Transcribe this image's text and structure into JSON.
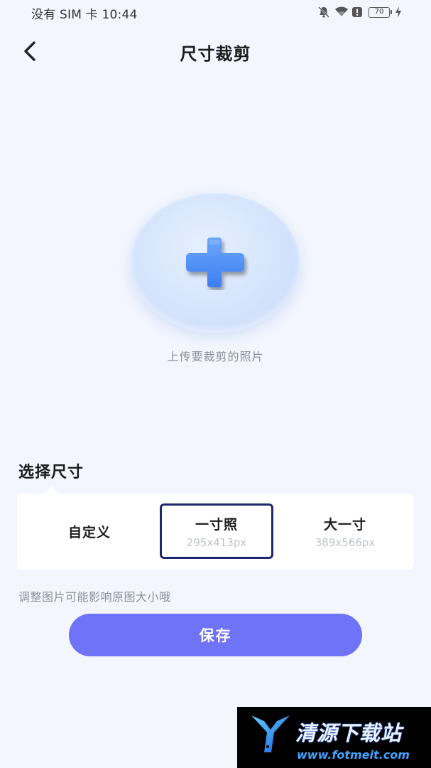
{
  "status_bar": {
    "carrier_time": "没有 SIM 卡 10:44",
    "battery": "70",
    "icons": [
      "bell-off-icon",
      "wifi-icon",
      "alert-icon",
      "battery-icon",
      "charging-icon"
    ]
  },
  "nav": {
    "back_icon": "chevron-left-icon",
    "title": "尺寸裁剪"
  },
  "upload": {
    "icon": "plus-icon",
    "hint": "上传要裁剪的照片"
  },
  "size_section": {
    "title": "选择尺寸",
    "selected_index": 1,
    "options": [
      {
        "label": "自定义",
        "dimension": ""
      },
      {
        "label": "一寸照",
        "dimension": "295x413px"
      },
      {
        "label": "大一寸",
        "dimension": "389x566px"
      }
    ]
  },
  "note": "调整图片可能影响原图大小哦",
  "save_label": "保存",
  "watermark": {
    "text": "清源下载站",
    "url": "www.fotmeit.com"
  },
  "colors": {
    "background": "#f3f6fe",
    "accent": "#6e73f7",
    "selected_border": "#1d2870",
    "plus": "#4d8cf5"
  }
}
